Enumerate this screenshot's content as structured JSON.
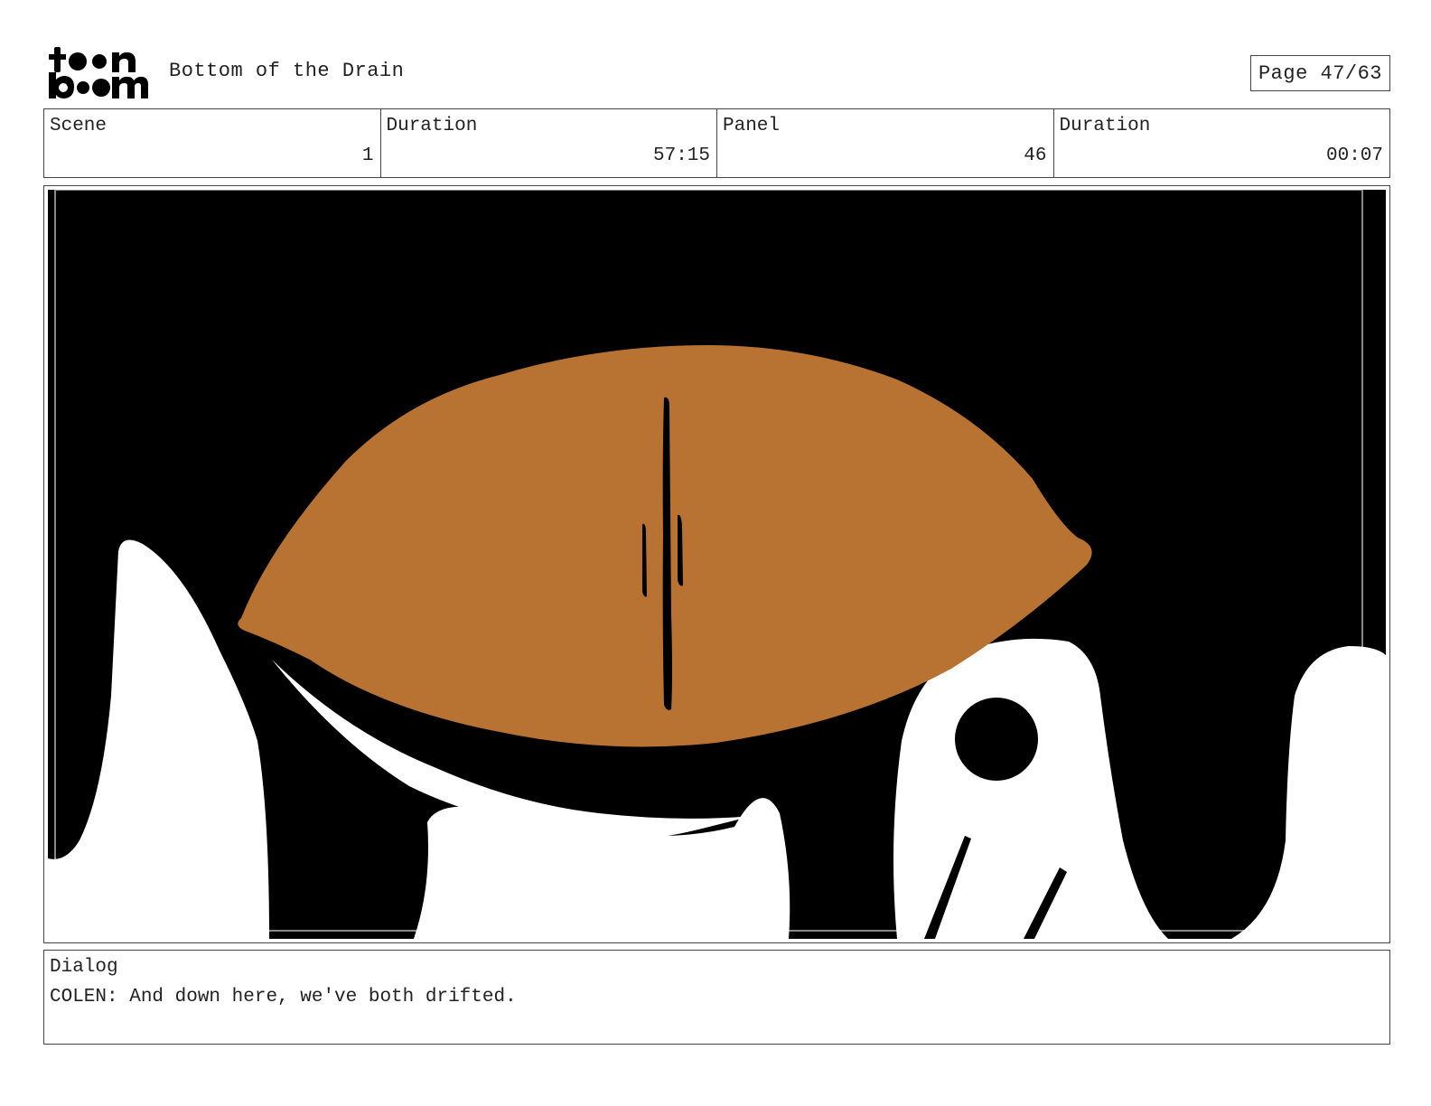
{
  "header": {
    "logo_text": "toonboom",
    "logo_icon": "toon-boom-logo-icon",
    "project_title": "Bottom of the Drain",
    "page_label": "Page 47/63"
  },
  "info": {
    "scene_label": "Scene",
    "scene_value": "1",
    "scene_duration_label": "Duration",
    "scene_duration_value": "57:15",
    "panel_label": "Panel",
    "panel_value": "46",
    "panel_duration_label": "Duration",
    "panel_duration_value": "00:07"
  },
  "panel": {
    "artwork_icon": "turtle-silhouette-illustration",
    "colors": {
      "background": "#000000",
      "shell": "#b87332",
      "body": "#ffffff"
    }
  },
  "dialog": {
    "label": "Dialog",
    "text": "COLEN: And down here, we've both drifted."
  }
}
